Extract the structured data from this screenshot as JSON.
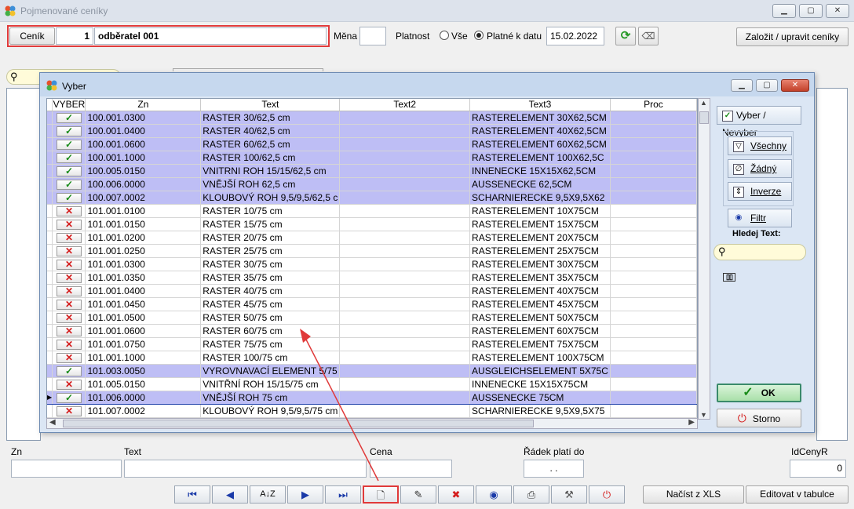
{
  "window": {
    "title": "Pojmenované ceníky"
  },
  "header": {
    "cenik_label": "Ceník",
    "cenik_number": "1",
    "cenik_name": "odběratel 001",
    "mena_label": "Měna",
    "mena_value": "",
    "platnost_label": "Platnost",
    "radio_all_label": "Vše",
    "radio_date_label": "Platné k datu",
    "date_value": "15.02.2022",
    "create_button": "Založit / upravit ceníky"
  },
  "dialog": {
    "title": "Vyber",
    "columns": [
      "VYBER",
      "Zn",
      "Text",
      "Text2",
      "Text3",
      "Proc"
    ],
    "rows": [
      {
        "sel": true,
        "zn": "100.001.0300",
        "text": "RASTER  30/62,5 cm",
        "text2": "",
        "text3": "RASTERELEMENT 30X62,5CM"
      },
      {
        "sel": true,
        "zn": "100.001.0400",
        "text": "RASTER  40/62,5 cm",
        "text2": "",
        "text3": "RASTERELEMENT 40X62,5CM"
      },
      {
        "sel": true,
        "zn": "100.001.0600",
        "text": "RASTER  60/62,5 cm",
        "text2": "",
        "text3": "RASTERELEMENT 60X62,5CM"
      },
      {
        "sel": true,
        "zn": "100.001.1000",
        "text": "RASTER 100/62,5 cm",
        "text2": "",
        "text3": "RASTERELEMENT 100X62,5C"
      },
      {
        "sel": true,
        "zn": "100.005.0150",
        "text": "VNITRNI ROH 15/15/62,5 cm",
        "text2": "",
        "text3": "INNENECKE 15X15X62,5CM"
      },
      {
        "sel": true,
        "zn": "100.006.0000",
        "text": "VNĚJŠÍ ROH 62,5 cm",
        "text2": "",
        "text3": "AUSSENECKE 62,5CM"
      },
      {
        "sel": true,
        "zn": "100.007.0002",
        "text": "KLOUBOVÝ ROH 9,5/9,5/62,5 c",
        "text2": "",
        "text3": "SCHARNIERECKE 9,5X9,5X62"
      },
      {
        "sel": false,
        "zn": "101.001.0100",
        "text": "RASTER  10/75 cm",
        "text2": "",
        "text3": "RASTERELEMENT 10X75CM"
      },
      {
        "sel": false,
        "zn": "101.001.0150",
        "text": "RASTER  15/75 cm",
        "text2": "",
        "text3": "RASTERELEMENT 15X75CM"
      },
      {
        "sel": false,
        "zn": "101.001.0200",
        "text": "RASTER  20/75 cm",
        "text2": "",
        "text3": "RASTERELEMENT 20X75CM"
      },
      {
        "sel": false,
        "zn": "101.001.0250",
        "text": "RASTER  25/75 cm",
        "text2": "",
        "text3": "RASTERELEMENT 25X75CM"
      },
      {
        "sel": false,
        "zn": "101.001.0300",
        "text": "RASTER  30/75 cm",
        "text2": "",
        "text3": "RASTERELEMENT 30X75CM"
      },
      {
        "sel": false,
        "zn": "101.001.0350",
        "text": "RASTER  35/75 cm",
        "text2": "",
        "text3": "RASTERELEMENT 35X75CM"
      },
      {
        "sel": false,
        "zn": "101.001.0400",
        "text": "RASTER  40/75 cm",
        "text2": "",
        "text3": "RASTERELEMENT 40X75CM"
      },
      {
        "sel": false,
        "zn": "101.001.0450",
        "text": "RASTER  45/75 cm",
        "text2": "",
        "text3": "RASTERELEMENT 45X75CM"
      },
      {
        "sel": false,
        "zn": "101.001.0500",
        "text": "RASTER  50/75 cm",
        "text2": "",
        "text3": "RASTERELEMENT 50X75CM"
      },
      {
        "sel": false,
        "zn": "101.001.0600",
        "text": "RASTER  60/75 cm",
        "text2": "",
        "text3": "RASTERELEMENT 60X75CM"
      },
      {
        "sel": false,
        "zn": "101.001.0750",
        "text": "RASTER  75/75 cm",
        "text2": "",
        "text3": "RASTERELEMENT 75X75CM"
      },
      {
        "sel": false,
        "zn": "101.001.1000",
        "text": "RASTER 100/75 cm",
        "text2": "",
        "text3": "RASTERELEMENT 100X75CM"
      },
      {
        "sel": true,
        "zn": "101.003.0050",
        "text": "VYROVNAVACÍ ELEMENT  5/75",
        "text2": "",
        "text3": "AUSGLEICHSELEMENT 5X75C"
      },
      {
        "sel": false,
        "zn": "101.005.0150",
        "text": "VNITŘNÍ ROH  15/15/75 cm",
        "text2": "",
        "text3": "INNENECKE 15X15X75CM"
      },
      {
        "sel": true,
        "cur": true,
        "zn": "101.006.0000",
        "text": "VNĚJŠÍ ROH  75 cm",
        "text2": "",
        "text3": "AUSSENECKE 75CM"
      },
      {
        "sel": false,
        "zn": "101.007.0002",
        "text": "KLOUBOVÝ ROH 9,5/9,5/75 cm",
        "text2": "",
        "text3": "SCHARNIERECKE 9,5X9,5X75"
      }
    ],
    "side": {
      "toggle": "Vyber / Nevyber",
      "all": "Všechny",
      "none": "Žádný",
      "invert": "Inverze",
      "filter": "Filtr",
      "search_label": "Hledej Text:",
      "search_value": "",
      "ok": "OK",
      "cancel": "Storno"
    }
  },
  "bottom": {
    "zn_label": "Zn",
    "text_label": "Text",
    "cena_label": "Cena",
    "radek_label": "Řádek platí do",
    "radek_value": ". .",
    "idcenyr_label": "IdCenyR",
    "idcenyr_value": "0",
    "import_button": "Načíst z XLS",
    "edit_button": "Editovat v tabulce"
  },
  "colors": {
    "selected_row": "#bebef5",
    "highlight_border": "#e03a3a",
    "check_green": "#188a18",
    "cross_red": "#d41c1c"
  }
}
